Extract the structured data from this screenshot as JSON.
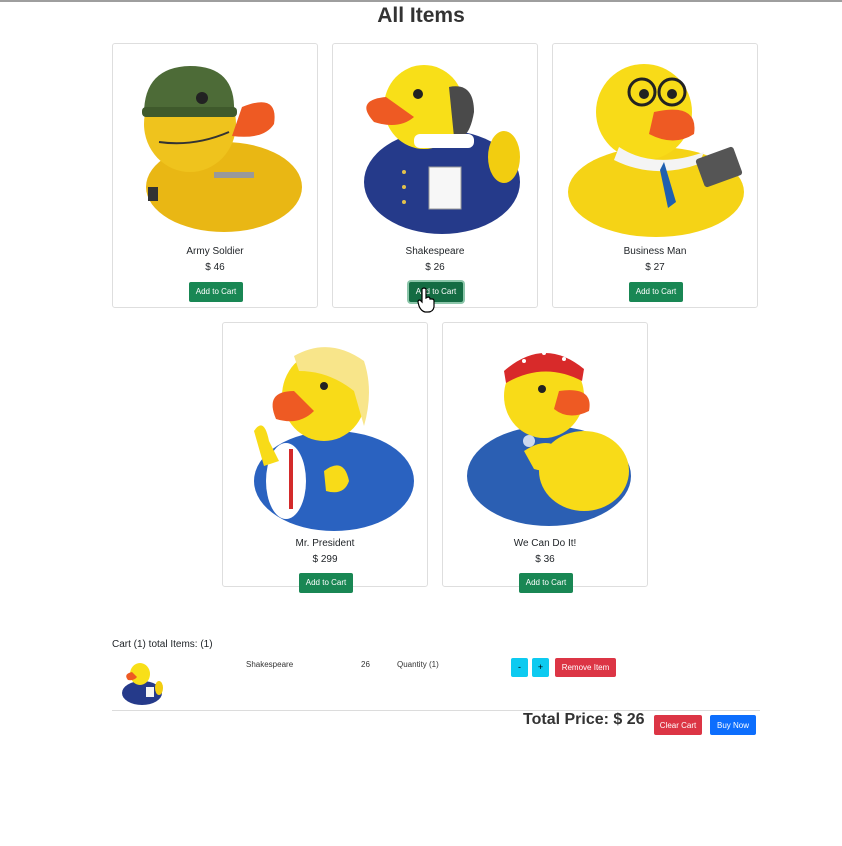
{
  "page": {
    "title": "All Items"
  },
  "products": [
    {
      "name": "Army Soldier",
      "price": "$ 46",
      "button": "Add to Cart"
    },
    {
      "name": "Shakespeare",
      "price": "$ 26",
      "button": "Add to Cart"
    },
    {
      "name": "Business Man",
      "price": "$ 27",
      "button": "Add to Cart"
    },
    {
      "name": "Mr. President",
      "price": "$ 299",
      "button": "Add to Cart"
    },
    {
      "name": "We Can Do It!",
      "price": "$ 36",
      "button": "Add to Cart"
    }
  ],
  "cart": {
    "heading": "Cart (1) total Items: (1)",
    "items": [
      {
        "name": "Shakespeare",
        "price": "26",
        "quantity": "Quantity (1)",
        "decrement": "-",
        "increment": "+",
        "remove": "Remove Item"
      }
    ],
    "total_price": "Total Price: $ 26",
    "clear_label": "Clear Cart",
    "buy_label": "Buy Now"
  },
  "colors": {
    "add_button": "#198754",
    "danger": "#dc3545",
    "info": "#0dcaf0",
    "primary": "#0d6efd"
  },
  "icons": [
    "hand-pointer-cursor-icon"
  ]
}
